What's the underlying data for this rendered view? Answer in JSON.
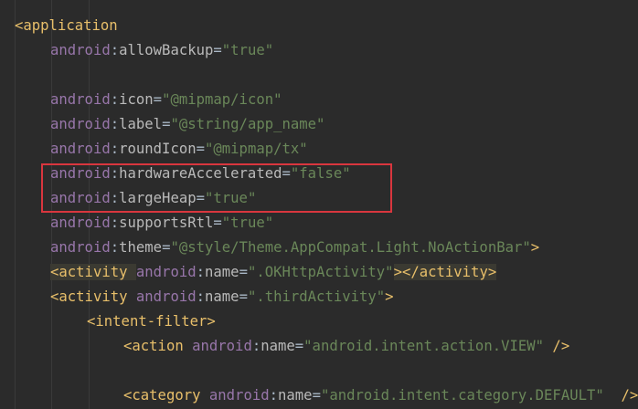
{
  "lines": [
    {
      "indent": 0,
      "parts": [
        [
          "tag",
          "<application"
        ]
      ]
    },
    {
      "indent": 1,
      "parts": [
        [
          "ns",
          "android"
        ],
        [
          "eq",
          ":"
        ],
        [
          "attr",
          "allowBackup"
        ],
        [
          "eq",
          "="
        ],
        [
          "str",
          "\"true\""
        ]
      ]
    },
    {
      "indent": 1,
      "parts": []
    },
    {
      "indent": 1,
      "parts": [
        [
          "ns",
          "android"
        ],
        [
          "eq",
          ":"
        ],
        [
          "attr",
          "icon"
        ],
        [
          "eq",
          "="
        ],
        [
          "str",
          "\"@mipmap/icon\""
        ]
      ]
    },
    {
      "indent": 1,
      "parts": [
        [
          "ns",
          "android"
        ],
        [
          "eq",
          ":"
        ],
        [
          "attr",
          "label"
        ],
        [
          "eq",
          "="
        ],
        [
          "str",
          "\"@string/app_name\""
        ]
      ]
    },
    {
      "indent": 1,
      "parts": [
        [
          "ns",
          "android"
        ],
        [
          "eq",
          ":"
        ],
        [
          "attr",
          "roundIcon"
        ],
        [
          "eq",
          "="
        ],
        [
          "str",
          "\"@mipmap/tx\""
        ]
      ]
    },
    {
      "indent": 1,
      "parts": [
        [
          "ns",
          "android"
        ],
        [
          "eq",
          ":"
        ],
        [
          "attr",
          "hardwareAccelerated"
        ],
        [
          "eq",
          "="
        ],
        [
          "str",
          "\"false\""
        ]
      ]
    },
    {
      "indent": 1,
      "parts": [
        [
          "ns",
          "android"
        ],
        [
          "eq",
          ":"
        ],
        [
          "attr",
          "largeHeap"
        ],
        [
          "eq",
          "="
        ],
        [
          "str",
          "\"true\""
        ]
      ]
    },
    {
      "indent": 1,
      "parts": [
        [
          "ns",
          "android"
        ],
        [
          "eq",
          ":"
        ],
        [
          "attr",
          "supportsRtl"
        ],
        [
          "eq",
          "="
        ],
        [
          "str",
          "\"true\""
        ]
      ]
    },
    {
      "indent": 1,
      "parts": [
        [
          "ns",
          "android"
        ],
        [
          "eq",
          ":"
        ],
        [
          "attr",
          "theme"
        ],
        [
          "eq",
          "="
        ],
        [
          "str",
          "\"@style/Theme.AppCompat.Light.NoActionBar\""
        ],
        [
          "tag",
          ">"
        ]
      ]
    },
    {
      "indent": 1,
      "highlight": true,
      "parts": [
        [
          "tag",
          "<activity "
        ],
        [
          "ns",
          "android"
        ],
        [
          "eq",
          ":"
        ],
        [
          "attr",
          "name"
        ],
        [
          "eq",
          "="
        ],
        [
          "str",
          "\".OKHttpActivity\""
        ],
        [
          "tag",
          "></activity>"
        ]
      ]
    },
    {
      "indent": 1,
      "parts": [
        [
          "tag",
          "<activity "
        ],
        [
          "ns",
          "android"
        ],
        [
          "eq",
          ":"
        ],
        [
          "attr",
          "name"
        ],
        [
          "eq",
          "="
        ],
        [
          "str",
          "\".thirdActivity\""
        ],
        [
          "tag",
          ">"
        ]
      ]
    },
    {
      "indent": 2,
      "parts": [
        [
          "tag",
          "<intent-filter>"
        ]
      ]
    },
    {
      "indent": 3,
      "parts": [
        [
          "tag",
          "<action "
        ],
        [
          "ns",
          "android"
        ],
        [
          "eq",
          ":"
        ],
        [
          "attr",
          "name"
        ],
        [
          "eq",
          "="
        ],
        [
          "str",
          "\"android.intent.action.VIEW\""
        ],
        [
          "tag",
          " />"
        ]
      ]
    },
    {
      "indent": 3,
      "parts": []
    },
    {
      "indent": 3,
      "parts": [
        [
          "tag",
          "<category "
        ],
        [
          "ns",
          "android"
        ],
        [
          "eq",
          ":"
        ],
        [
          "attr",
          "name"
        ],
        [
          "eq",
          "="
        ],
        [
          "str",
          "\"android.intent.category.DEFAULT\""
        ],
        [
          "tag",
          "  />"
        ]
      ]
    }
  ],
  "annotation": {
    "color": "#d9363e",
    "label": "highlighted-attributes"
  }
}
